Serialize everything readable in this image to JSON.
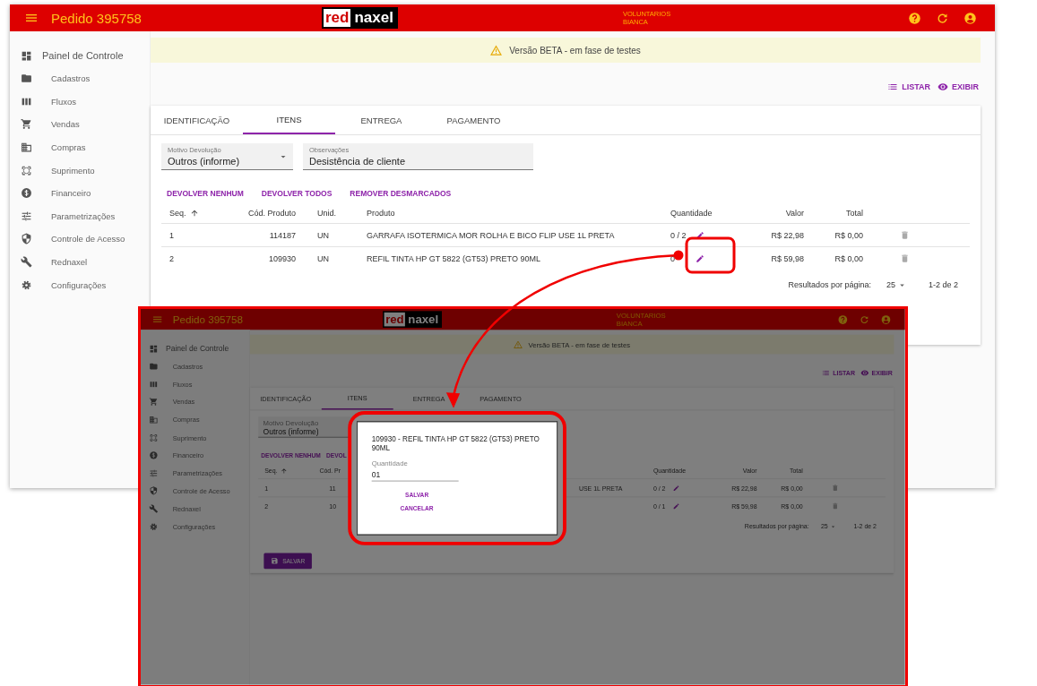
{
  "main_window": {
    "header": {
      "title": "Pedido 395758",
      "logo": [
        "red",
        "naxel"
      ],
      "user": [
        "VOLUNTARIOS",
        "BIANCA"
      ]
    },
    "sidebar": {
      "items": [
        {
          "kind": "heading",
          "label": "Painel de Controle"
        },
        {
          "kind": "link",
          "label": "Cadastros"
        },
        {
          "kind": "link",
          "label": "Fluxos"
        },
        {
          "kind": "link",
          "label": "Vendas"
        },
        {
          "kind": "link",
          "label": "Compras"
        },
        {
          "kind": "link",
          "label": "Suprimento"
        },
        {
          "kind": "link",
          "label": "Financeiro"
        },
        {
          "kind": "link",
          "label": "Parametrizações"
        },
        {
          "kind": "link",
          "label": "Controle de Acesso"
        },
        {
          "kind": "link",
          "label": "Rednaxel"
        },
        {
          "kind": "link",
          "label": "Configurações"
        }
      ]
    },
    "banner": {
      "text": "Versão BETA - em fase de testes"
    },
    "view_buttons": [
      "LISTAR",
      "EXIBIR"
    ],
    "tabs": [
      {
        "label": "IDENTIFICAÇÃO",
        "selected": false
      },
      {
        "label": "ITENS",
        "selected": true
      },
      {
        "label": "ENTREGA",
        "selected": false
      },
      {
        "label": "PAGAMENTO",
        "selected": false
      }
    ],
    "fields": [
      {
        "kind": "select",
        "label": "Motivo Devolução",
        "value": "Outros (informe)"
      },
      {
        "kind": "text",
        "label": "Observações",
        "value": "Desistência de cliente"
      }
    ],
    "actions": [
      "DEVOLVER NENHUM",
      "DEVOLVER TODOS",
      "REMOVER DESMARCADOS"
    ],
    "table": {
      "columns": [
        {
          "kind": "seq",
          "label": "Seq.",
          "sorted": true
        },
        {
          "kind": "code",
          "label": "Cód. Produto",
          "sorted": false
        },
        {
          "kind": "unit",
          "label": "Unid.",
          "sorted": false
        },
        {
          "kind": "product",
          "label": "Produto",
          "sorted": false
        },
        {
          "kind": "quantity",
          "label": "Quantidade",
          "sorted": false
        },
        {
          "kind": "value",
          "label": "Valor",
          "sorted": false
        },
        {
          "kind": "total",
          "label": "Total",
          "sorted": false
        }
      ],
      "rows": [
        {
          "seq": "1",
          "code": "114187",
          "unit": "UN",
          "product": "GARRAFA ISOTERMICA MOR ROLHA E BICO FLIP USE 1L PRETA",
          "quantity": "0 / 2",
          "value": "R$ 22,98",
          "total": "R$ 0,00"
        },
        {
          "seq": "2",
          "code": "109930",
          "unit": "UN",
          "product": "REFIL TINTA HP GT 5822 (GT53) PRETO 90ML",
          "quantity": "0",
          "value": "R$ 59,98",
          "total": "R$ 0,00"
        }
      ]
    },
    "pagination": {
      "label": "Resultados por página:",
      "page_size": "25",
      "range": "1-2 de 2"
    }
  },
  "inset_window": {
    "header": {
      "title": "Pedido 395758",
      "logo": [
        "red",
        "naxel"
      ],
      "user": [
        "VOLUNTARIOS",
        "BIANCA"
      ]
    },
    "sidebar": {
      "items": [
        {
          "kind": "heading",
          "label": "Painel de Controle"
        },
        {
          "kind": "link",
          "label": "Cadastros"
        },
        {
          "kind": "link",
          "label": "Fluxos"
        },
        {
          "kind": "link",
          "label": "Vendas"
        },
        {
          "kind": "link",
          "label": "Compras"
        },
        {
          "kind": "link",
          "label": "Suprimento"
        },
        {
          "kind": "link",
          "label": "Financeiro"
        },
        {
          "kind": "link",
          "label": "Parametrizações"
        },
        {
          "kind": "link",
          "label": "Controle de Acesso"
        },
        {
          "kind": "link",
          "label": "Rednaxel"
        },
        {
          "kind": "link",
          "label": "Configurações"
        }
      ]
    },
    "banner": {
      "text": "Versão BETA - em fase de testes"
    },
    "view_buttons": [
      "LISTAR",
      "EXIBIR"
    ],
    "tabs": [
      {
        "label": "IDENTIFICAÇÃO",
        "selected": false
      },
      {
        "label": "ITENS",
        "selected": true
      },
      {
        "label": "ENTREGA",
        "selected": false
      },
      {
        "label": "PAGAMENTO",
        "selected": false
      }
    ],
    "fields": [
      {
        "label": "Motivo Devolução",
        "value": "Outros (informe)"
      }
    ],
    "actions": [
      "DEVOLVER NENHUM",
      "DEVOL"
    ],
    "table": {
      "columns": [
        {
          "kind": "seq",
          "label": "Seq.",
          "sorted": true
        },
        {
          "kind": "code",
          "label": "Cód. Pr",
          "sorted": false
        },
        {
          "kind": "quantity",
          "label": "Quantidade",
          "sorted": false
        },
        {
          "kind": "value",
          "label": "Valor",
          "sorted": false
        },
        {
          "kind": "total",
          "label": "Total",
          "sorted": false
        }
      ],
      "rows": [
        {
          "seq": "1",
          "code": "11",
          "product": "USE 1L PRETA",
          "quantity": "0 / 2",
          "value": "R$ 22,98",
          "total": "R$ 0,00"
        },
        {
          "seq": "2",
          "code": "10",
          "quantity": "0 / 1",
          "value": "R$ 59,98",
          "total": "R$ 0,00"
        }
      ]
    },
    "pagination": {
      "label": "Resultados por página:",
      "page_size": "25",
      "range": "1-2 de 2"
    },
    "save_button": "SALVAR",
    "dialog": {
      "title": "109930 - REFIL TINTA HP GT 5822 (GT53) PRETO 90ML",
      "field": {
        "label": "Quantidade",
        "value": "01"
      },
      "buttons": [
        "SALVAR",
        "CANCELAR"
      ]
    }
  }
}
